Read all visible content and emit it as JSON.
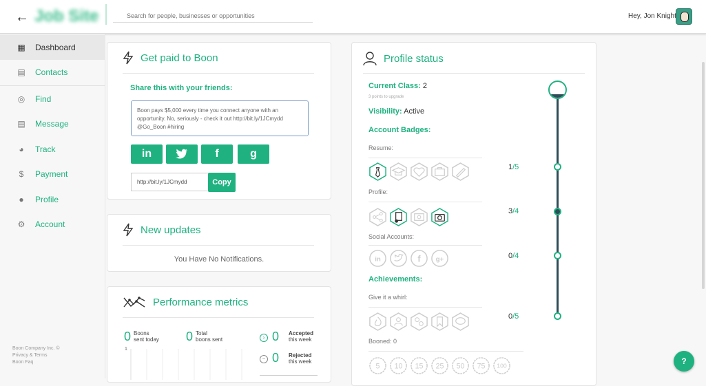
{
  "header": {
    "logo": "Job Site",
    "search_placeholder": "Search for people, businesses or opportunities",
    "greeting": "Hey, Jon Knight"
  },
  "sidebar": {
    "items": [
      {
        "label": "Dashboard",
        "icon": "dashboard-icon"
      },
      {
        "label": "Contacts",
        "icon": "contacts-icon"
      },
      {
        "label": "Find",
        "icon": "target-icon"
      },
      {
        "label": "Message",
        "icon": "message-icon"
      },
      {
        "label": "Track",
        "icon": "track-icon"
      },
      {
        "label": "Payment",
        "icon": "dollar-icon"
      },
      {
        "label": "Profile",
        "icon": "person-icon"
      },
      {
        "label": "Account",
        "icon": "gear-icon"
      }
    ],
    "footer": {
      "company": "Boon Company Inc. ©",
      "privacy": "Privacy",
      "amp": "&",
      "terms": "Terms",
      "faq": "Boon Faq"
    }
  },
  "get_paid": {
    "title": "Get paid to Boon",
    "share_label": "Share this with your friends:",
    "share_text": "Boon pays $5,000 every time you connect anyone with an opportunity. No, seriously - check it out http://bit.ly/1JCmydd @Go_Boon #hiring",
    "social": [
      "in",
      "twitter",
      "f",
      "g"
    ],
    "link": "http://bit.ly/1JCmydd",
    "copy_label": "Copy"
  },
  "updates": {
    "title": "New updates",
    "message": "You Have No Notifications."
  },
  "metrics": {
    "title": "Performance metrics",
    "boons_sent_today": {
      "value": "0",
      "label1": "Boons",
      "label2": "sent today"
    },
    "total_boons_sent": {
      "value": "0",
      "label1": "Total",
      "label2": "boons sent"
    },
    "accepted": {
      "value": "0",
      "label1": "Accepted",
      "label2": "this week"
    },
    "rejected": {
      "value": "0",
      "label1": "Rejected",
      "label2": "this week"
    },
    "chart_tick": "1"
  },
  "profile_status": {
    "title": "Profile status",
    "current_class_label": "Current Class:",
    "current_class_value": "2",
    "points_to_upgrade": "3 points to upgrade",
    "visibility_label": "Visibility:",
    "visibility_value": "Active",
    "account_badges": "Account Badges:",
    "resume_label": "Resume:",
    "resume_progress": {
      "done": "1",
      "total": "/5"
    },
    "profile_label": "Profile:",
    "profile_progress": {
      "done": "3",
      "total": "/4"
    },
    "social_label": "Social Accounts:",
    "social_progress": {
      "done": "0",
      "total": "/4"
    },
    "achievements": "Achievements:",
    "whirl_label": "Give it a whirl:",
    "whirl_progress": {
      "done": "0",
      "total": "/5"
    },
    "booned_label": "Booned: 0",
    "booned_badges": [
      "5",
      "10",
      "15",
      "25",
      "50",
      "75",
      "100"
    ]
  },
  "colors": {
    "accent": "#1fb280",
    "dark": "#2f4d59"
  }
}
